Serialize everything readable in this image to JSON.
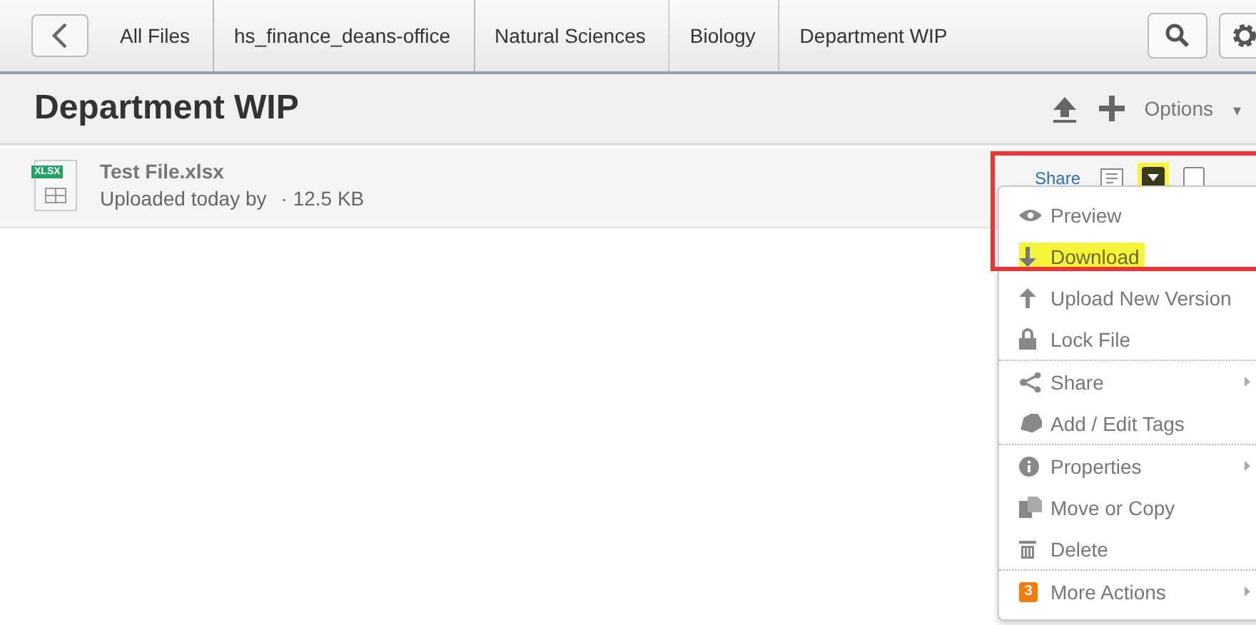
{
  "breadcrumbs": [
    {
      "label": "All Files"
    },
    {
      "label": "hs_finance_deans-office"
    },
    {
      "label": "Natural Sciences"
    },
    {
      "label": "Biology"
    },
    {
      "label": "Department WIP"
    }
  ],
  "title": "Department WIP",
  "options": "Options",
  "options_caret": "▾",
  "file": {
    "name": "Test File.xlsx",
    "badge": "XLSX",
    "meta": "Uploaded today by",
    "size": "· 12.5 KB",
    "share": "Share",
    "menu_open": true,
    "selected": false
  },
  "menu": [
    {
      "kind": "preview",
      "label": "Preview",
      "highlighted": false,
      "submenu": false,
      "divider_after": false
    },
    {
      "kind": "download",
      "label": "Download",
      "highlighted": true,
      "submenu": false,
      "divider_after": false
    },
    {
      "kind": "upload",
      "label": "Upload New Version",
      "highlighted": false,
      "submenu": false,
      "divider_after": false
    },
    {
      "kind": "lock",
      "label": "Lock File",
      "highlighted": false,
      "submenu": false,
      "divider_after": true
    },
    {
      "kind": "share",
      "label": "Share",
      "highlighted": false,
      "submenu": true,
      "divider_after": false
    },
    {
      "kind": "tag",
      "label": "Add / Edit Tags",
      "highlighted": false,
      "submenu": false,
      "divider_after": true
    },
    {
      "kind": "info",
      "label": "Properties",
      "highlighted": false,
      "submenu": true,
      "divider_after": false
    },
    {
      "kind": "copy",
      "label": "Move or Copy",
      "highlighted": false,
      "submenu": false,
      "divider_after": false
    },
    {
      "kind": "delete",
      "label": "Delete",
      "highlighted": false,
      "submenu": false,
      "divider_after": true
    },
    {
      "kind": "more",
      "label": "More Actions",
      "badge": "3",
      "highlighted": false,
      "submenu": true,
      "divider_after": false
    }
  ]
}
